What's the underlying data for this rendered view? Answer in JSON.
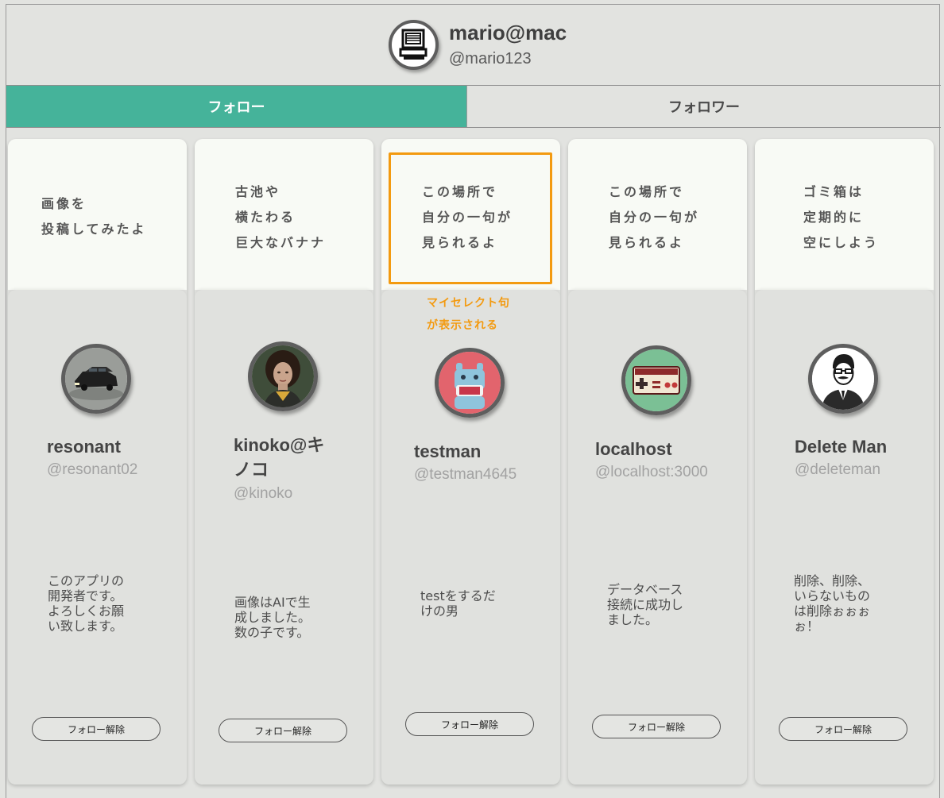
{
  "profile": {
    "name": "mario@mac",
    "handle": "@mario123",
    "avatar_icon": "retro-computer-icon"
  },
  "tabs": [
    {
      "label": "フォロー",
      "active": true
    },
    {
      "label": "フォロワー",
      "active": false
    }
  ],
  "accent_color": "#45b39a",
  "highlight_color": "#f39a10",
  "annotation": {
    "line1": "マイセレクト句",
    "line2": "が表示される"
  },
  "cards": [
    {
      "phrase": [
        "画像を",
        "投稿してみたよ"
      ],
      "avatar": "car-avatar",
      "name": "resonant",
      "handle": "@resonant02",
      "bio": [
        "このアプリの",
        "開発者です。",
        "よろしくお願",
        "い致します。"
      ],
      "button": "フォロー解除"
    },
    {
      "phrase": [
        "古池や",
        "横たわる",
        "巨大なバナナ"
      ],
      "avatar": "woman-portrait-avatar",
      "name_lines": [
        "kinoko@キ",
        "ノコ"
      ],
      "handle": "@kinoko",
      "bio": [
        "画像はAIで生",
        "成しました。",
        "数の子です。"
      ],
      "button": "フォロー解除"
    },
    {
      "phrase": [
        "この場所で",
        "自分の一句が",
        "見られるよ"
      ],
      "avatar": "hippo-avatar",
      "name": "testman",
      "handle": "@testman4645",
      "bio": [
        "testをするだ",
        "けの男"
      ],
      "button": "フォロー解除"
    },
    {
      "phrase": [
        "この場所で",
        "自分の一句が",
        "見られるよ"
      ],
      "avatar": "game-controller-avatar",
      "name": "localhost",
      "handle": "@localhost:3000",
      "bio": [
        "データベース",
        "接続に成功し",
        "ました。"
      ],
      "button": "フォロー解除"
    },
    {
      "phrase": [
        "ゴミ箱は",
        "定期的に",
        "空にしよう"
      ],
      "avatar": "man-suit-avatar",
      "name": "Delete Man",
      "handle": "@deleteman",
      "bio": [
        "削除、削除、",
        "いらないもの",
        "は削除ぉぉぉ",
        "ぉ！"
      ],
      "button": "フォロー解除"
    }
  ]
}
